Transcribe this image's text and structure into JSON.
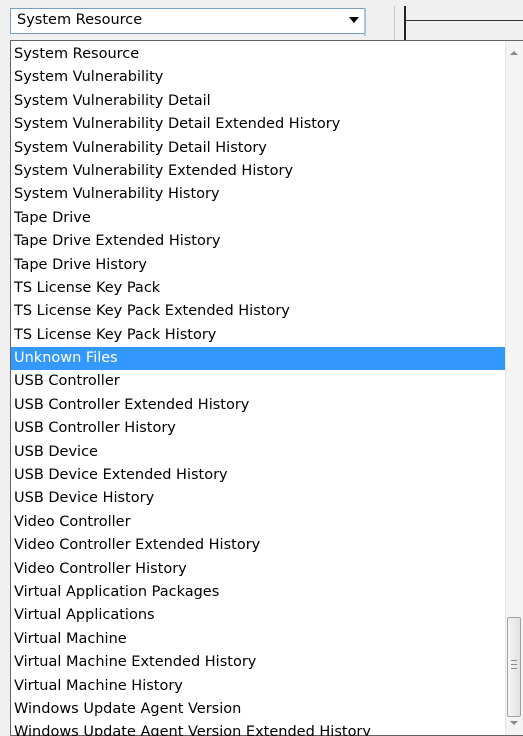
{
  "combo": {
    "selected_value": "System Resource",
    "arrow_icon": "chevron-down-icon"
  },
  "dropdown": {
    "selected_index": 14,
    "items": [
      "System Resource",
      "System Vulnerability",
      "System Vulnerability Detail",
      "System Vulnerability Detail Extended History",
      "System Vulnerability Detail History",
      "System Vulnerability Extended History",
      "System Vulnerability History",
      "Tape Drive",
      "Tape Drive Extended History",
      "Tape Drive History",
      "TS License Key Pack",
      "TS License Key Pack Extended History",
      "TS License Key Pack History",
      "Unknown Files",
      "USB Controller",
      "USB Controller Extended History",
      "USB Controller History",
      "USB Device",
      "USB Device Extended History",
      "USB Device History",
      "Video Controller",
      "Video Controller Extended History",
      "Video Controller History",
      "Virtual Application Packages",
      "Virtual Applications",
      "Virtual Machine",
      "Virtual Machine Extended History",
      "Virtual Machine History",
      "Windows Update Agent Version",
      "Windows Update Agent Version Extended History"
    ]
  },
  "scrollbar": {
    "position_fraction": 0.95,
    "up_icon": "scroll-up-arrow-icon",
    "down_icon": "scroll-down-arrow-icon"
  },
  "colors": {
    "selection": "#3399ff",
    "selection_text": "#ffffff",
    "combo_border": "#7a9cbf"
  }
}
